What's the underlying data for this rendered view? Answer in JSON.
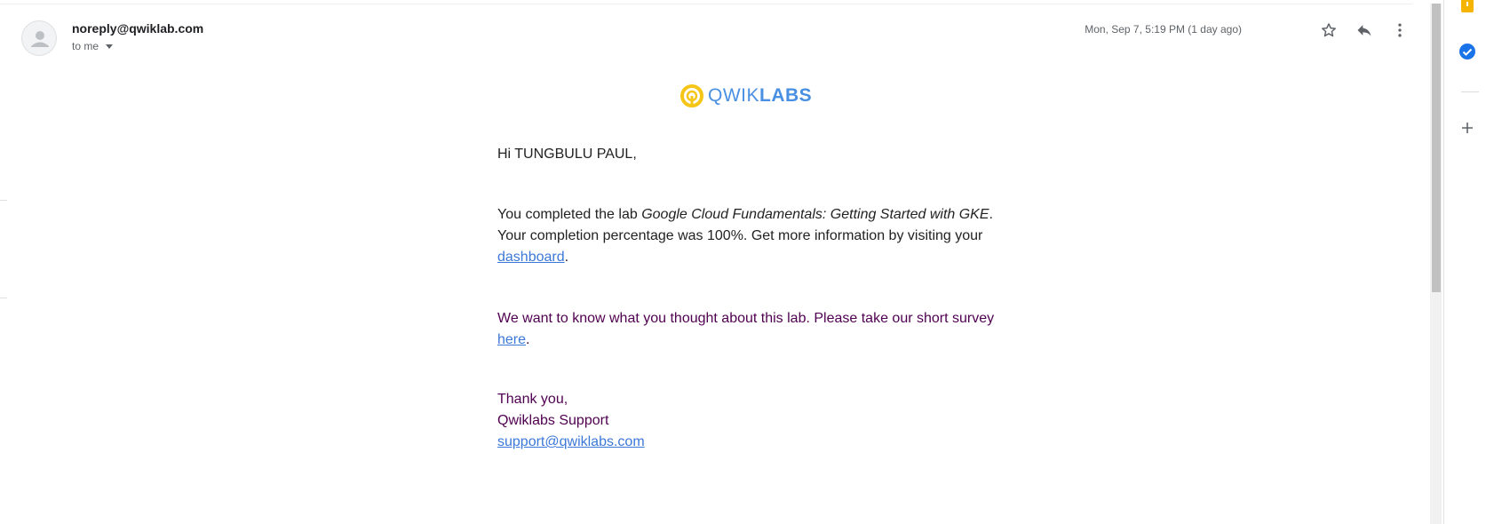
{
  "header": {
    "sender": "noreply@qwiklab.com",
    "recipient": "to me",
    "date": "Mon, Sep 7, 5:19 PM (1 day ago)",
    "icons": [
      "star-icon",
      "reply-icon",
      "more-vert-icon"
    ]
  },
  "logo": {
    "light": "QWIK",
    "bold": "LABS",
    "colors": {
      "ring": "#f5c518",
      "text": "#4a90e2"
    }
  },
  "body": {
    "greeting": "Hi TUNGBULU PAUL,",
    "completed_prefix": "You completed the lab ",
    "lab_name": "Google Cloud Fundamentals: Getting Started with GKE",
    "completed_suffix": ". Your completion percentage was 100%. Get more information by visiting your ",
    "dashboard_link": "dashboard",
    "period": ".",
    "survey_text": "We want to know what you thought about this lab. Please take our short survey ",
    "survey_link": "here",
    "thanks": "Thank you,",
    "team": "Qwiklabs Support",
    "support_email": "support@qwiklabs.com"
  },
  "side_panel": {
    "icons": [
      "keep-icon",
      "tasks-icon",
      "add-icon"
    ],
    "colors": {
      "keep": "#f4b400",
      "tasks": "#1a73e8"
    }
  },
  "colors": {
    "link": "#3c78d8",
    "quoted_text": "#500050"
  }
}
